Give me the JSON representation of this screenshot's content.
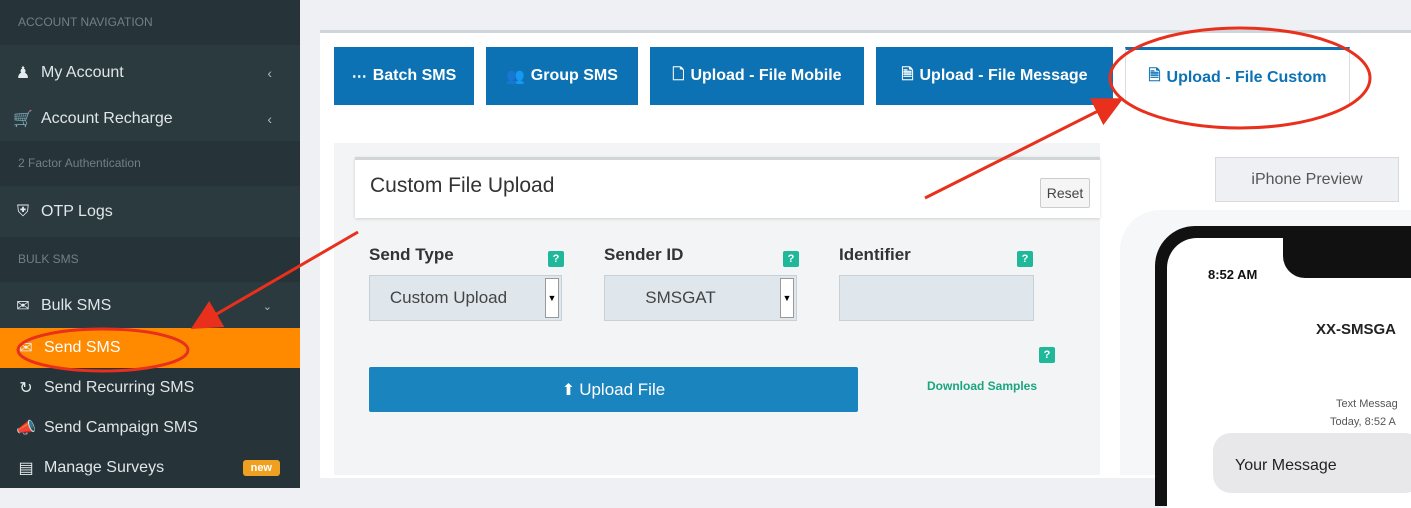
{
  "sidebar": {
    "section_account": "ACCOUNT NAVIGATION",
    "my_account": "My Account",
    "account_recharge": "Account Recharge",
    "section_2fa": "2 Factor Authentication",
    "otp_logs": "OTP Logs",
    "section_bulk": "BULK SMS",
    "bulk_sms": "Bulk SMS",
    "send_sms": "Send SMS",
    "send_recurring": "Send Recurring SMS",
    "send_campaign": "Send Campaign SMS",
    "manage_surveys": "Manage Surveys",
    "badge_new": "new"
  },
  "tabs": {
    "batch": "Batch SMS",
    "group": "Group SMS",
    "file_mobile": "Upload - File Mobile",
    "file_message": "Upload - File Message",
    "file_custom": "Upload - File Custom"
  },
  "form": {
    "title": "Custom File Upload",
    "reset": "Reset",
    "send_type_label": "Send Type",
    "send_type_value": "Custom Upload",
    "sender_label": "Sender ID",
    "sender_value": "SMSGAT",
    "identifier_label": "Identifier",
    "help": "?",
    "upload": "Upload File",
    "download_samples": "Download Samples"
  },
  "preview": {
    "tab": "iPhone Preview",
    "time": "8:52 AM",
    "contact": "XX-SMSGA",
    "meta1": "Text Messag",
    "meta2": "Today, 8:52 A",
    "message": "Your Message"
  },
  "colors": {
    "sidebar": "#2b3a3f",
    "active": "#ff8a00",
    "tab_blue": "#0c72b4",
    "annotation": "#e8301c"
  }
}
